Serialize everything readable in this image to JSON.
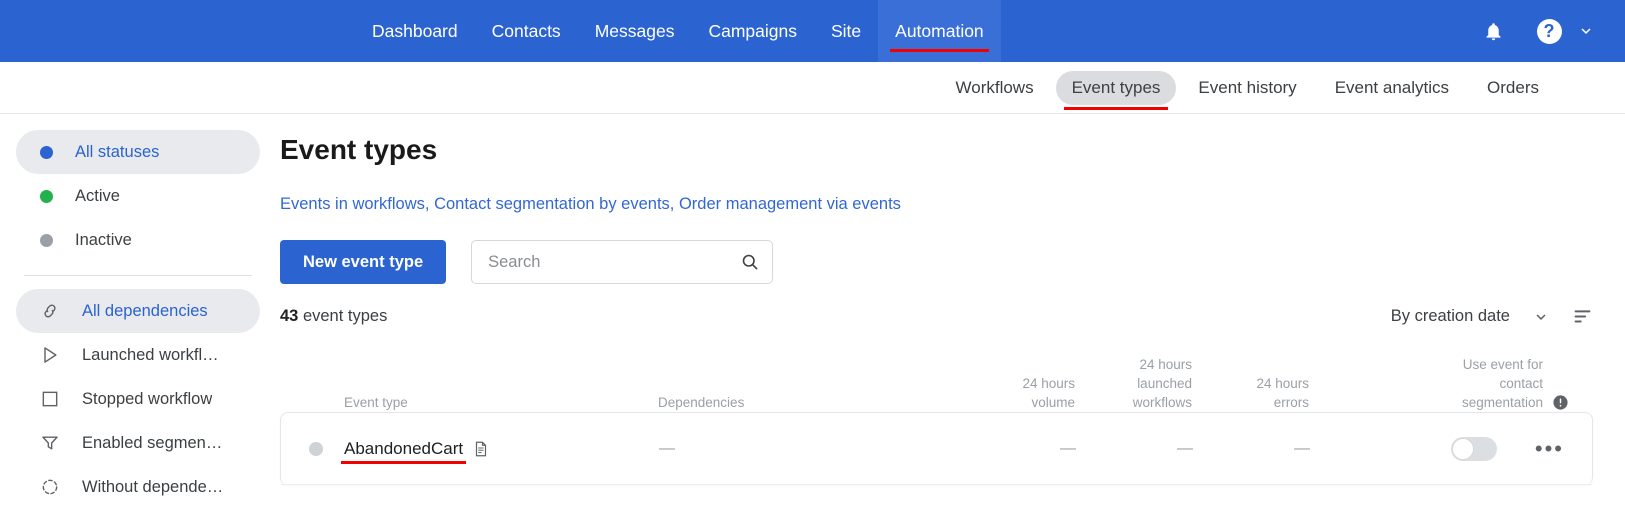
{
  "topnav": {
    "links": [
      {
        "label": "Dashboard",
        "active": false
      },
      {
        "label": "Contacts",
        "active": false
      },
      {
        "label": "Messages",
        "active": false
      },
      {
        "label": "Campaigns",
        "active": false
      },
      {
        "label": "Site",
        "active": false
      },
      {
        "label": "Automation",
        "active": true
      }
    ],
    "icons": {
      "notifications": "bell-icon",
      "help": "help-circle-icon",
      "account_menu": "chevron-down-icon"
    },
    "background": "#2b63d0",
    "annotation_color": "#f40000"
  },
  "subnav": {
    "links": [
      {
        "label": "Workflows",
        "selected": false
      },
      {
        "label": "Event types",
        "selected": true
      },
      {
        "label": "Event history",
        "selected": false
      },
      {
        "label": "Event analytics",
        "selected": false
      },
      {
        "label": "Orders",
        "selected": false
      }
    ]
  },
  "sidebar": {
    "status_group": [
      {
        "label": "All statuses",
        "icon": "status-dot-all",
        "color": "#2b63d0",
        "selected": true
      },
      {
        "label": "Active",
        "icon": "status-dot-active",
        "color": "#22b14c",
        "selected": false
      },
      {
        "label": "Inactive",
        "icon": "status-dot-inactive",
        "color": "#9aa0a6",
        "selected": false
      }
    ],
    "dependency_group": [
      {
        "label": "All dependencies",
        "icon": "link-chain-icon",
        "selected": true
      },
      {
        "label": "Launched workfl…",
        "icon": "play-triangle-icon",
        "selected": false
      },
      {
        "label": "Stopped workflow",
        "icon": "square-icon",
        "selected": false
      },
      {
        "label": "Enabled segmen…",
        "icon": "funnel-icon",
        "selected": false
      },
      {
        "label": "Without depende…",
        "icon": "dashed-circle-icon",
        "selected": false
      }
    ]
  },
  "main": {
    "title": "Event types",
    "links": [
      "Events in workflows",
      "Contact segmentation by events",
      "Order management via events"
    ],
    "link_separator": ", ",
    "new_button_label": "New event type",
    "search": {
      "value": "",
      "placeholder": "Search",
      "icon": "search-icon"
    },
    "count": {
      "number": "43",
      "label": "event types"
    },
    "sort": {
      "label": "By creation date",
      "chevron_icon": "chevron-down-icon",
      "list_icon": "sort-list-icon"
    }
  },
  "table": {
    "headers": {
      "event_type": "Event type",
      "dependencies": "Dependencies",
      "volume_24h": "24 hours\nvolume",
      "launched_workflows_24h": "24 hours\nlaunched\nworkflows",
      "errors_24h": "24 hours\nerrors",
      "segmentation": "Use event for\ncontact\nsegmentation",
      "segmentation_info_icon": "info-icon"
    },
    "rows": [
      {
        "status": "inactive",
        "name": "AbandonedCart",
        "annotated": true,
        "doc_icon": "document-icon",
        "dependencies": "—",
        "volume_24h": "—",
        "launched_workflows_24h": "—",
        "errors_24h": "—",
        "segmentation_enabled": false,
        "menu_icon": "kebab-menu-icon",
        "menu_label": "•••"
      }
    ]
  }
}
